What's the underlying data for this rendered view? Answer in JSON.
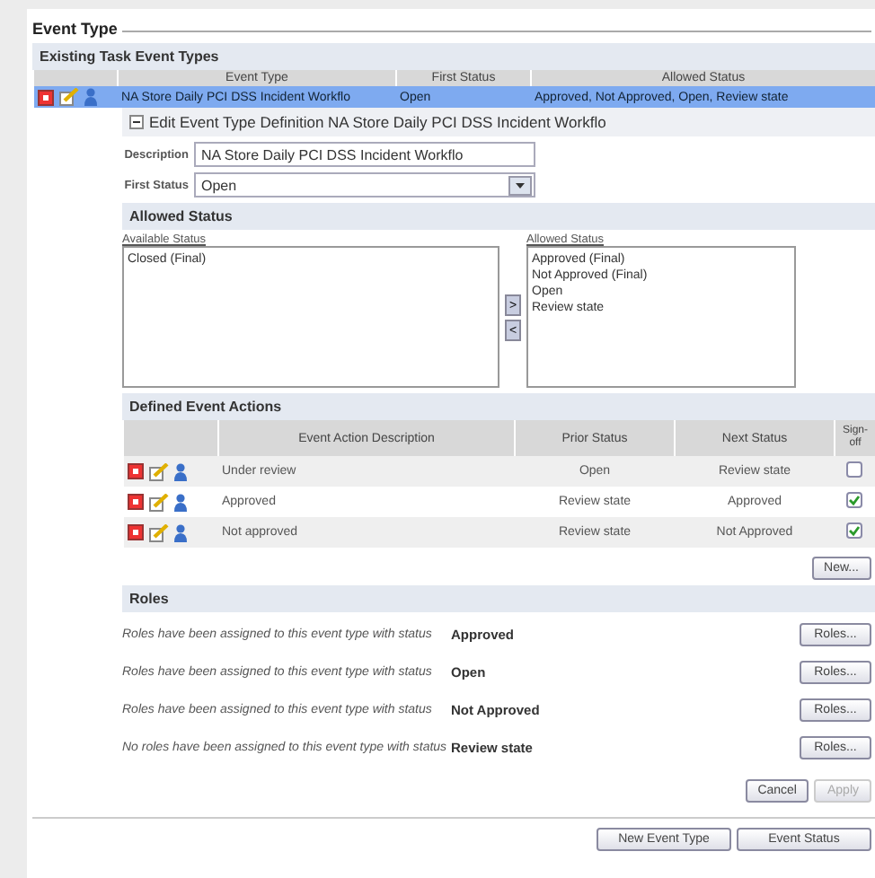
{
  "section_title": "Event Type",
  "existing": {
    "title": "Existing Task Event Types",
    "columns": [
      "Event Type",
      "First Status",
      "Allowed Status"
    ],
    "rows": [
      {
        "event_type": "NA Store Daily PCI DSS Incident Workflo",
        "first_status": "Open",
        "allowed_status": "Approved, Not Approved, Open, Review state",
        "selected": true
      }
    ]
  },
  "edit": {
    "title": "Edit Event Type Definition NA Store Daily PCI DSS Incident Workflo",
    "expanded": true,
    "description_label": "Description",
    "description": "NA Store Daily PCI DSS Incident Workflo",
    "first_status_label": "First Status",
    "first_status": "Open"
  },
  "allowed_status": {
    "title": "Allowed Status",
    "available_label": "Available Status",
    "available": [
      "Closed (Final)"
    ],
    "allowed_label": "Allowed Status",
    "allowed": [
      "Approved (Final)",
      "Not Approved (Final)",
      "Open",
      "Review state"
    ],
    "add_button": ">",
    "remove_button": "<"
  },
  "actions": {
    "title": "Defined Event Actions",
    "columns": [
      "Event Action Description",
      "Prior Status",
      "Next Status",
      "Sign-off"
    ],
    "rows": [
      {
        "description": "Under review",
        "prior": "Open",
        "next": "Review state",
        "signoff": false
      },
      {
        "description": "Approved",
        "prior": "Review state",
        "next": "Approved",
        "signoff": true
      },
      {
        "description": "Not approved",
        "prior": "Review state",
        "next": "Not Approved",
        "signoff": true
      }
    ],
    "new_button": "New..."
  },
  "roles": {
    "title": "Roles",
    "rows": [
      {
        "message": "Roles have been assigned to this event type with status",
        "status": "Approved",
        "button": "Roles..."
      },
      {
        "message": "Roles have been assigned to this event type with status",
        "status": "Open",
        "button": "Roles..."
      },
      {
        "message": "Roles have been assigned to this event type with status",
        "status": "Not Approved",
        "button": "Roles..."
      },
      {
        "message": "No roles have been assigned to this event type with status",
        "status": "Review state",
        "button": "Roles..."
      }
    ]
  },
  "form_buttons": [
    {
      "label": "Cancel",
      "disabled": false
    },
    {
      "label": "Apply",
      "disabled": true
    }
  ],
  "bottom_buttons": [
    "New Event Type",
    "Event Status"
  ]
}
